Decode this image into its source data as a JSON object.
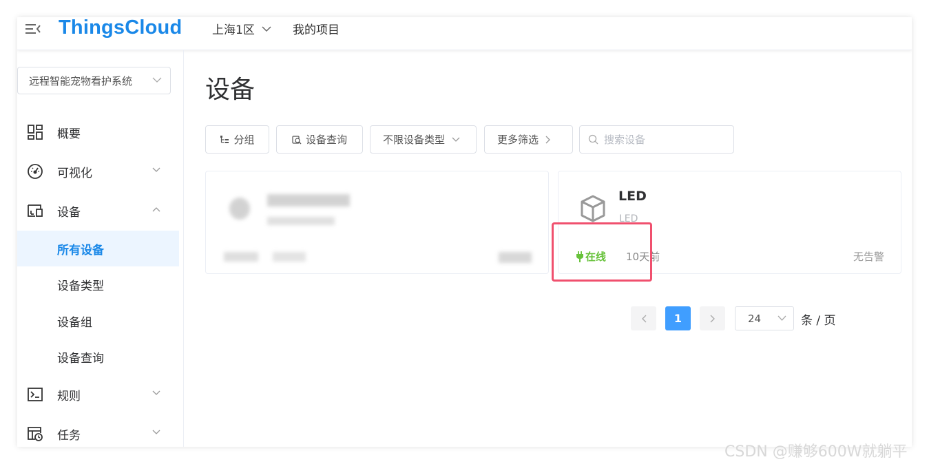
{
  "header": {
    "logo": "ThingsCloud",
    "region": "上海1区",
    "my_projects": "我的项目"
  },
  "sidebar": {
    "project": "远程智能宠物看护系统",
    "items": [
      {
        "label": "概要",
        "icon": "dashboard-grid-icon"
      },
      {
        "label": "可视化",
        "icon": "gauge-icon"
      },
      {
        "label": "设备",
        "icon": "devices-icon"
      },
      {
        "label": "规则",
        "icon": "terminal-icon"
      },
      {
        "label": "任务",
        "icon": "task-clock-icon"
      }
    ],
    "sub_items": [
      "所有设备",
      "设备类型",
      "设备组",
      "设备查询"
    ]
  },
  "main": {
    "title": "设备",
    "filters": {
      "group": "分组",
      "query": "设备查询",
      "type": "不限设备类型",
      "more": "更多筛选",
      "search_placeholder": "搜索设备"
    },
    "card": {
      "name": "LED",
      "type": "LED",
      "status": "在线",
      "time": "10天前",
      "alarm": "无告警"
    },
    "pagination": {
      "current": "1",
      "page_size": "24",
      "unit": "条 / 页"
    }
  },
  "watermark": "CSDN @赚够600W就躺平",
  "colors": {
    "brand": "#1a88e8",
    "online": "#67c23a",
    "highlight": "#f0506e",
    "page_active": "#409eff"
  }
}
